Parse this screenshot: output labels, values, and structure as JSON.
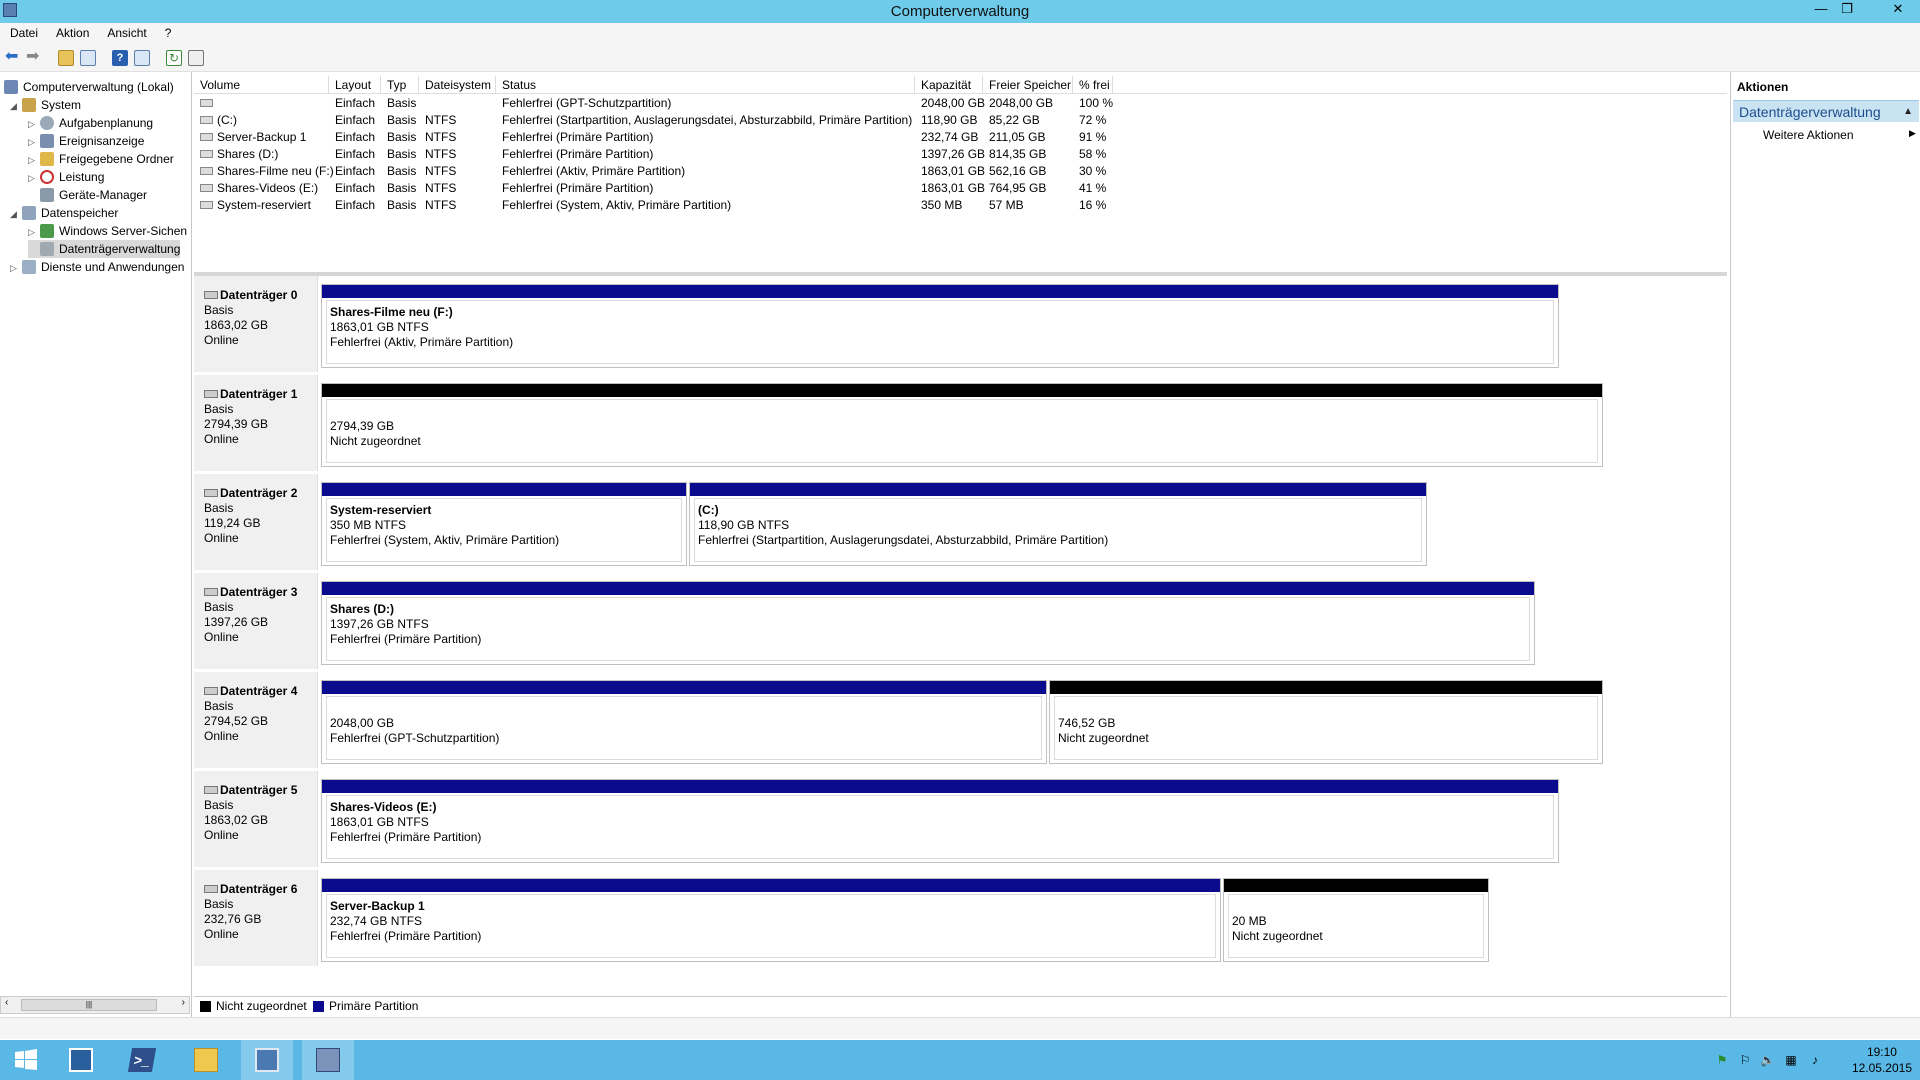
{
  "window": {
    "title": "Computerverwaltung",
    "minimize": "—",
    "restore": "❐",
    "close": "✕"
  },
  "menu": [
    "Datei",
    "Aktion",
    "Ansicht",
    "?"
  ],
  "tree": [
    {
      "label": "Computerverwaltung (Lokal)",
      "arrow": "",
      "level": 0
    },
    {
      "label": "System",
      "arrow": "◢",
      "level": 1
    },
    {
      "label": "Aufgabenplanung",
      "arrow": "▷",
      "level": 2
    },
    {
      "label": "Ereignisanzeige",
      "arrow": "▷",
      "level": 2
    },
    {
      "label": "Freigegebene Ordner",
      "arrow": "▷",
      "level": 2
    },
    {
      "label": "Leistung",
      "arrow": "▷",
      "level": 2
    },
    {
      "label": "Geräte-Manager",
      "arrow": "",
      "level": 2
    },
    {
      "label": "Datenspeicher",
      "arrow": "◢",
      "level": 1
    },
    {
      "label": "Windows Server-Sichen",
      "arrow": "▷",
      "level": 2
    },
    {
      "label": "Datenträgerverwaltung",
      "arrow": "",
      "level": 2
    },
    {
      "label": "Dienste und Anwendungen",
      "arrow": "▷",
      "level": 1
    }
  ],
  "volume_table": {
    "columns": [
      "Volume",
      "Layout",
      "Typ",
      "Dateisystem",
      "Status",
      "Kapazität",
      "Freier Speicher",
      "% frei"
    ],
    "rows": [
      [
        "",
        "Einfach",
        "Basis",
        "",
        "Fehlerfrei (GPT-Schutzpartition)",
        "2048,00 GB",
        "2048,00 GB",
        "100 %"
      ],
      [
        "(C:)",
        "Einfach",
        "Basis",
        "NTFS",
        "Fehlerfrei (Startpartition, Auslagerungsdatei, Absturzabbild, Primäre Partition)",
        "118,90 GB",
        "85,22 GB",
        "72 %"
      ],
      [
        "Server-Backup 1",
        "Einfach",
        "Basis",
        "NTFS",
        "Fehlerfrei (Primäre Partition)",
        "232,74 GB",
        "211,05 GB",
        "91 %"
      ],
      [
        "Shares (D:)",
        "Einfach",
        "Basis",
        "NTFS",
        "Fehlerfrei (Primäre Partition)",
        "1397,26 GB",
        "814,35 GB",
        "58 %"
      ],
      [
        "Shares-Filme neu (F:)",
        "Einfach",
        "Basis",
        "NTFS",
        "Fehlerfrei (Aktiv, Primäre Partition)",
        "1863,01 GB",
        "562,16 GB",
        "30 %"
      ],
      [
        "Shares-Videos (E:)",
        "Einfach",
        "Basis",
        "NTFS",
        "Fehlerfrei (Primäre Partition)",
        "1863,01 GB",
        "764,95 GB",
        "41 %"
      ],
      [
        "System-reserviert",
        "Einfach",
        "Basis",
        "NTFS",
        "Fehlerfrei (System, Aktiv, Primäre Partition)",
        "350 MB",
        "57 MB",
        "16 %"
      ]
    ]
  },
  "disks": [
    {
      "name": "Datenträger 0",
      "type": "Basis",
      "size": "1863,02 GB",
      "state": "Online",
      "partitions": [
        {
          "title": "Shares-Filme neu  (F:)",
          "line2": "1863,01 GB NTFS",
          "line3": "Fehlerfrei (Aktiv, Primäre Partition)",
          "kind": "primary"
        }
      ]
    },
    {
      "name": "Datenträger 1",
      "type": "Basis",
      "size": "2794,39 GB",
      "state": "Online",
      "partitions": [
        {
          "title": "",
          "line2": "2794,39 GB",
          "line3": "Nicht zugeordnet",
          "kind": "unallocated"
        }
      ]
    },
    {
      "name": "Datenträger 2",
      "type": "Basis",
      "size": "119,24 GB",
      "state": "Online",
      "partitions": [
        {
          "title": "System-reserviert",
          "line2": "350 MB NTFS",
          "line3": "Fehlerfrei (System, Aktiv, Primäre Partition)",
          "kind": "primary"
        },
        {
          "title": "(C:)",
          "line2": "118,90 GB NTFS",
          "line3": "Fehlerfrei (Startpartition, Auslagerungsdatei, Absturzabbild, Primäre Partition)",
          "kind": "primary"
        }
      ]
    },
    {
      "name": "Datenträger 3",
      "type": "Basis",
      "size": "1397,26 GB",
      "state": "Online",
      "partitions": [
        {
          "title": "Shares  (D:)",
          "line2": "1397,26 GB NTFS",
          "line3": "Fehlerfrei (Primäre Partition)",
          "kind": "primary"
        }
      ]
    },
    {
      "name": "Datenträger 4",
      "type": "Basis",
      "size": "2794,52 GB",
      "state": "Online",
      "partitions": [
        {
          "title": "",
          "line2": "2048,00 GB",
          "line3": "Fehlerfrei (GPT-Schutzpartition)",
          "kind": "primary"
        },
        {
          "title": "",
          "line2": "746,52 GB",
          "line3": "Nicht zugeordnet",
          "kind": "unallocated"
        }
      ]
    },
    {
      "name": "Datenträger 5",
      "type": "Basis",
      "size": "1863,02 GB",
      "state": "Online",
      "partitions": [
        {
          "title": "Shares-Videos  (E:)",
          "line2": "1863,01 GB NTFS",
          "line3": "Fehlerfrei (Primäre Partition)",
          "kind": "primary"
        }
      ]
    },
    {
      "name": "Datenträger 6",
      "type": "Basis",
      "size": "232,76 GB",
      "state": "Online",
      "partitions": [
        {
          "title": "Server-Backup 1",
          "line2": "232,74 GB NTFS",
          "line3": "Fehlerfrei (Primäre Partition)",
          "kind": "primary"
        },
        {
          "title": "",
          "line2": "20 MB",
          "line3": "Nicht zugeordnet",
          "kind": "unallocated"
        }
      ]
    }
  ],
  "legend": {
    "unallocated": "Nicht zugeordnet",
    "primary": "Primäre Partition"
  },
  "colors": {
    "primary": "#0b0b8e",
    "unallocated": "#000000",
    "titlebar": "#6fcbea",
    "taskbar": "#5ab8e6"
  },
  "actions": {
    "header": "Aktionen",
    "section": "Datenträgerverwaltung",
    "more": "Weitere Aktionen"
  },
  "taskbar": {
    "time": "19:10",
    "date": "12.05.2015"
  },
  "scroll_thumb": "|||"
}
